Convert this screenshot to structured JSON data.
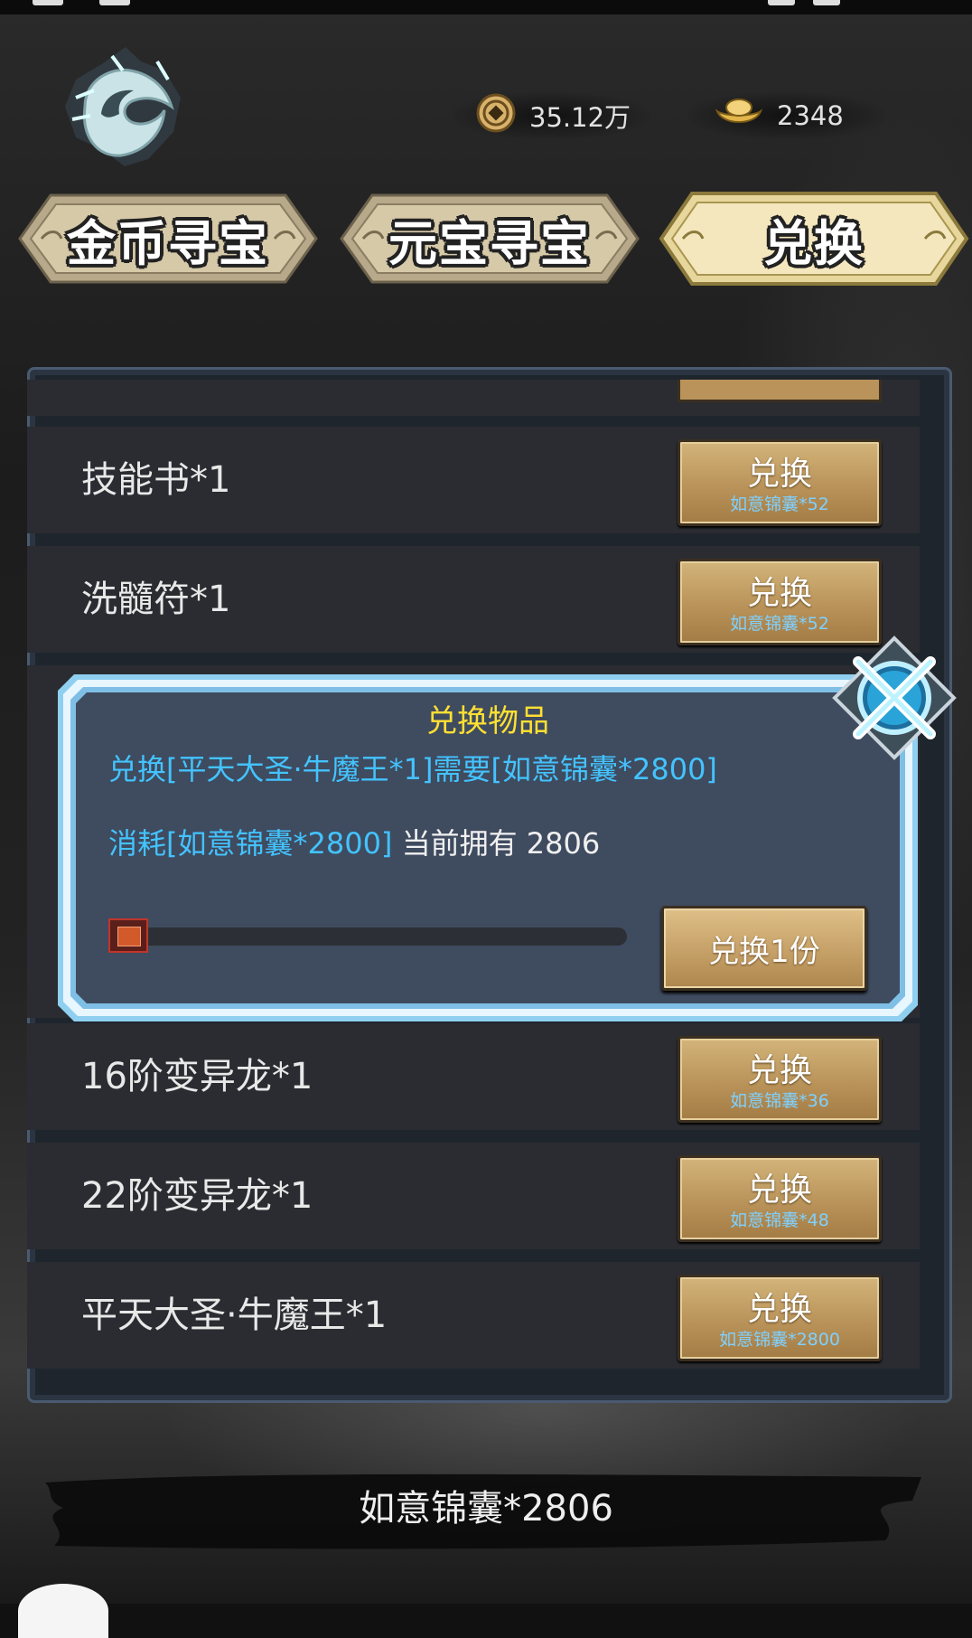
{
  "currency": {
    "coins": "35.12万",
    "ingots": "2348"
  },
  "tabs": [
    {
      "label": "金币寻宝"
    },
    {
      "label": "元宝寻宝"
    },
    {
      "label": "兑换"
    }
  ],
  "items": [
    {
      "name": "技能书*1",
      "button": "兑换",
      "cost": "如意锦囊*52"
    },
    {
      "name": "洗髓符*1",
      "button": "兑换",
      "cost": "如意锦囊*52"
    },
    {
      "name": "16阶变异龙*1",
      "button": "兑换",
      "cost": "如意锦囊*36"
    },
    {
      "name": "22阶变异龙*1",
      "button": "兑换",
      "cost": "如意锦囊*48"
    },
    {
      "name": "平天大圣·牛魔王*1",
      "button": "兑换",
      "cost": "如意锦囊*2800"
    }
  ],
  "dialog": {
    "title": "兑换物品",
    "line1": "兑换[平天大圣·牛魔王*1]需要[如意锦囊*2800]",
    "line2_cost": "消耗[如意锦囊*2800]",
    "line2_owned": " 当前拥有 2806",
    "confirm": "兑换1份",
    "slider_fraction": 0
  },
  "footer": {
    "inventory": "如意锦囊*2806"
  },
  "colors": {
    "gold_button": "#c2a066",
    "dialog_bg": "#3e4a5e",
    "dialog_text": "#43c3ff",
    "title_yellow": "#ffe033"
  },
  "icons": [
    "copper-coin-icon",
    "gold-ingot-icon",
    "dragon-emblem-icon",
    "close-icon"
  ]
}
